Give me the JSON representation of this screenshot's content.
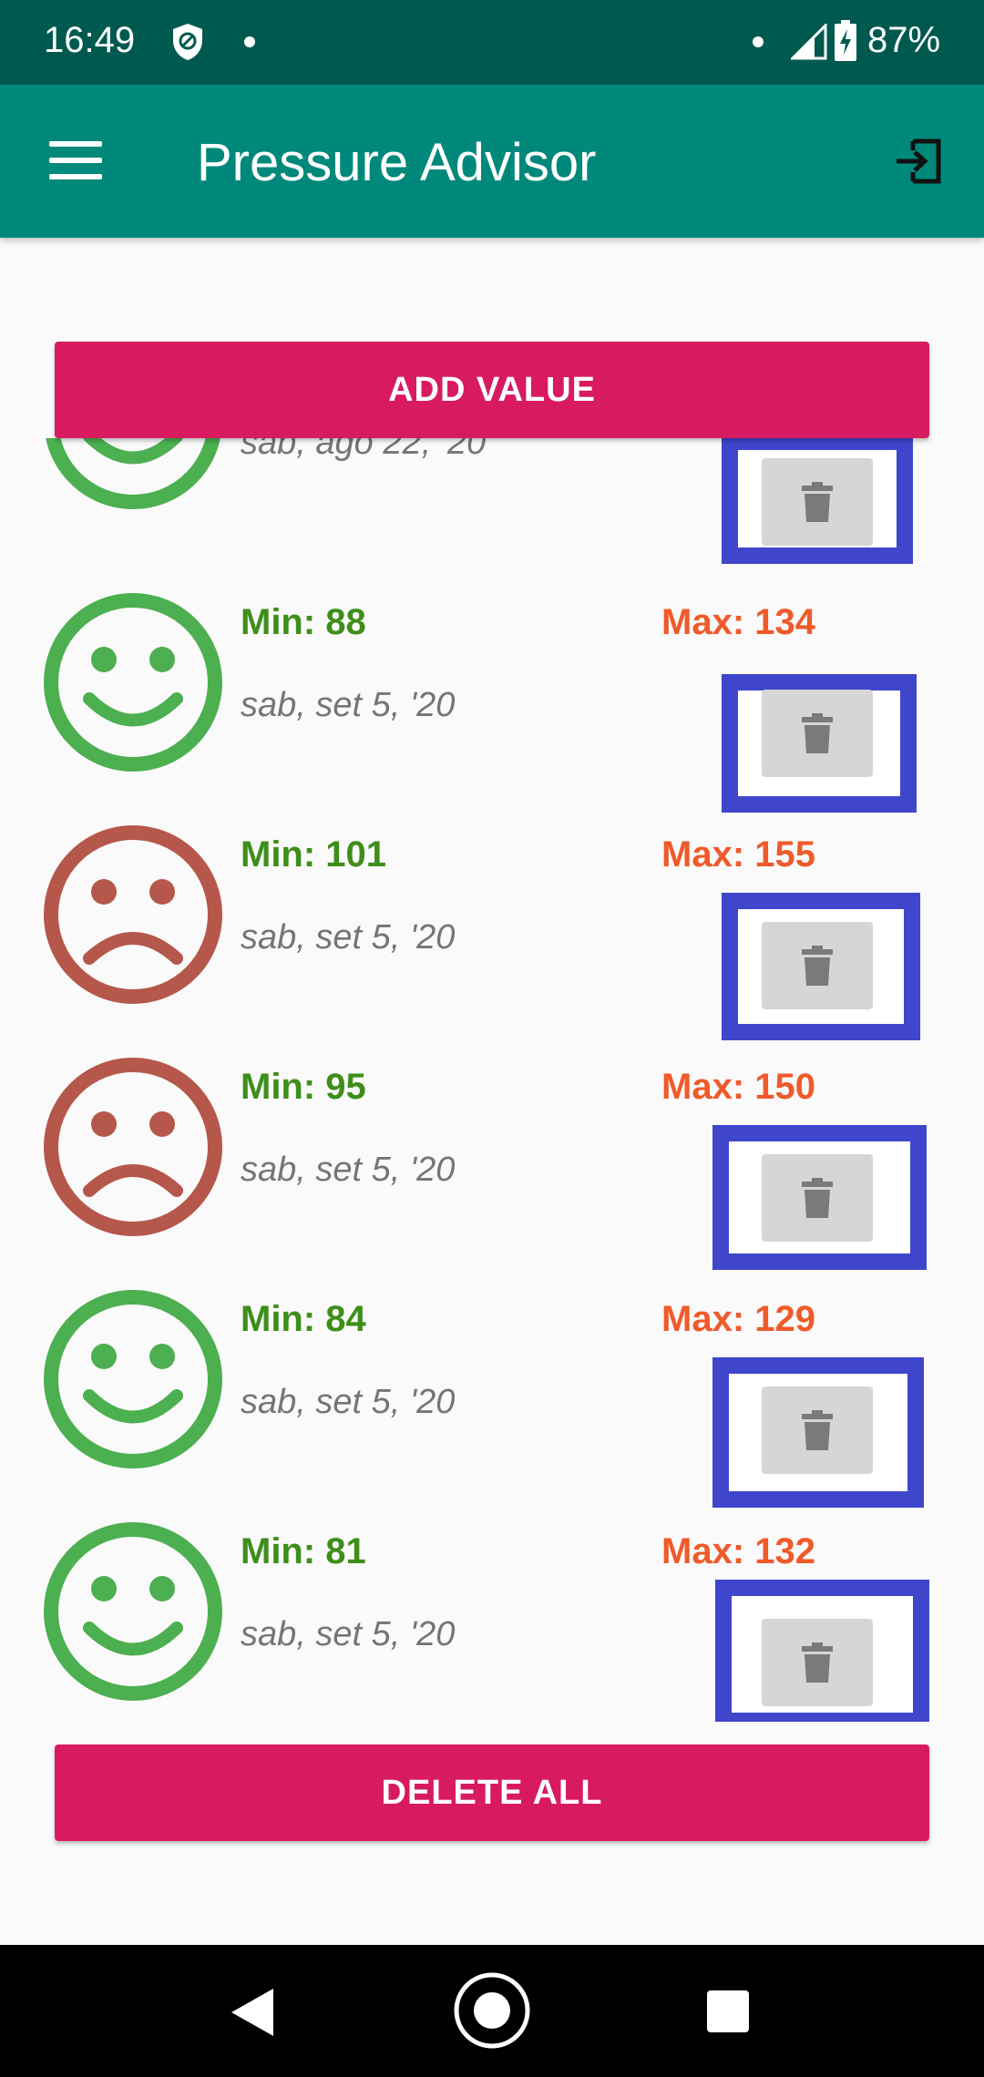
{
  "status_bar": {
    "time": "16:49",
    "battery": "87%",
    "icons": [
      "shield-icon",
      "dot-icon",
      "dot-icon",
      "signal-icon",
      "battery-charging-icon"
    ]
  },
  "app_bar": {
    "title": "Pressure Advisor",
    "menu_icon": "menu-icon",
    "logout_icon": "logout-icon"
  },
  "actions": {
    "add_value": "ADD VALUE",
    "delete_all": "DELETE ALL"
  },
  "colors": {
    "app_bar": "#00897b",
    "status_bar": "#00594f",
    "accent": "#d81b60",
    "good": "#4caf50",
    "bad": "#b5574a",
    "min_text": "#3e8e1a",
    "max_text": "#f05a2a",
    "highlight_frame": "#3f46cc"
  },
  "entries": [
    {
      "min": "",
      "max": "",
      "date": "sab, ago 22, '20",
      "mood": "happy"
    },
    {
      "min": "Min: 88",
      "max": "Max: 134",
      "date": "sab, set 5, '20",
      "mood": "happy"
    },
    {
      "min": "Min: 101",
      "max": "Max: 155",
      "date": "sab, set 5, '20",
      "mood": "sad"
    },
    {
      "min": "Min: 95",
      "max": "Max: 150",
      "date": "sab, set 5, '20",
      "mood": "sad"
    },
    {
      "min": "Min: 84",
      "max": "Max: 129",
      "date": "sab, set 5, '20",
      "mood": "happy"
    },
    {
      "min": "Min: 81",
      "max": "Max: 132",
      "date": "sab, set 5, '20",
      "mood": "happy"
    }
  ],
  "nav_bar": {
    "icons": [
      "back-icon",
      "home-icon",
      "recents-icon"
    ]
  }
}
